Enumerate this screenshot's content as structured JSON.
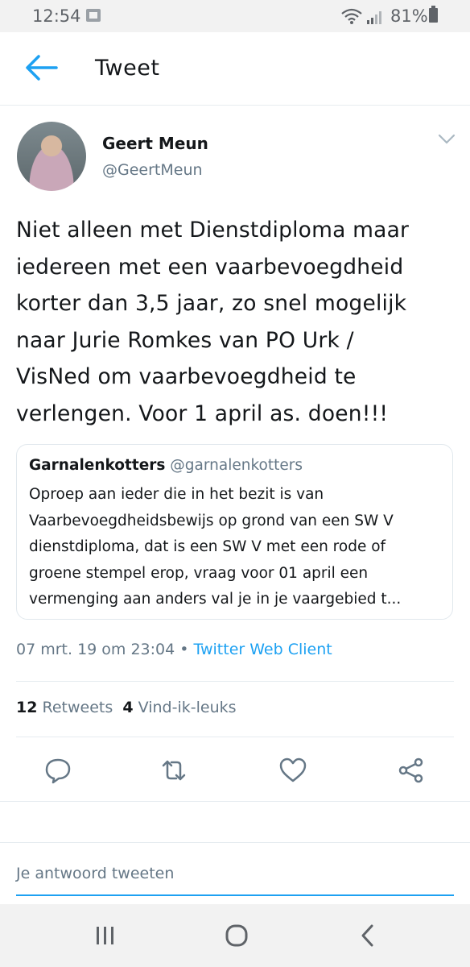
{
  "status_bar": {
    "time": "12:54",
    "battery": "81%"
  },
  "header": {
    "title": "Tweet"
  },
  "tweet": {
    "author_name": "Geert Meun",
    "author_handle": "@GeertMeun",
    "text_lines": [
      "Niet alleen met Dienstdiploma maar",
      "iedereen met een vaarbevoegdheid",
      "korter dan 3,5 jaar, zo snel mogelijk",
      "naar Jurie Romkes van PO Urk /",
      "VisNed om vaarbevoegdheid te",
      "verlengen. Voor 1 april as. doen!!!"
    ],
    "quoted": {
      "name": "Garnalenkotters",
      "handle": "@garnalenkotters",
      "text_lines": [
        "Oproep aan ieder die in het bezit is van",
        "Vaarbevoegdheidsbewijs op grond van een SW V",
        "dienstdiploma, dat is een SW V met een rode of",
        "groene stempel erop, vraag voor 01 april een",
        "vermenging aan anders val je in je vaargebied t..."
      ]
    },
    "timestamp": "07 mrt. 19 om 23:04",
    "separator": "•",
    "client": "Twitter Web Client",
    "retweet_count": "12",
    "retweet_label": "Retweets",
    "like_count": "4",
    "like_label": "Vind-ik-leuks"
  },
  "reply": {
    "placeholder": "Je antwoord tweeten"
  },
  "icons": {
    "back": "arrow-left-icon",
    "caret": "chevron-down-icon",
    "reply": "comment-icon",
    "retweet": "retweet-icon",
    "like": "heart-icon",
    "share": "share-icon",
    "nav_recent": "recent-apps-icon",
    "nav_home": "home-icon",
    "nav_back": "nav-back-icon"
  },
  "colors": {
    "accent": "#1da1f2",
    "secondary_text": "#657786",
    "text": "#14171a"
  }
}
